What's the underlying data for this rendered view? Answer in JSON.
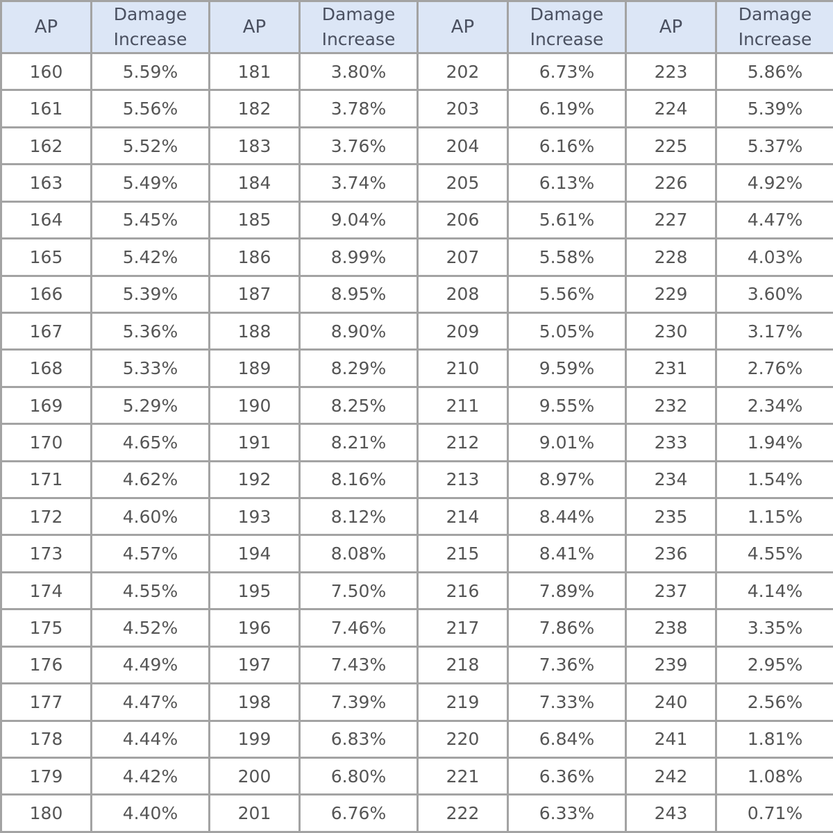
{
  "headers": {
    "ap": "AP",
    "damage_line1": "Damage",
    "damage_line2": "Increase"
  },
  "groups": [
    {
      "rows": [
        [
          "160",
          "5.59%"
        ],
        [
          "161",
          "5.56%"
        ],
        [
          "162",
          "5.52%"
        ],
        [
          "163",
          "5.49%"
        ],
        [
          "164",
          "5.45%"
        ],
        [
          "165",
          "5.42%"
        ],
        [
          "166",
          "5.39%"
        ],
        [
          "167",
          "5.36%"
        ],
        [
          "168",
          "5.33%"
        ],
        [
          "169",
          "5.29%"
        ],
        [
          "170",
          "4.65%"
        ],
        [
          "171",
          "4.62%"
        ],
        [
          "172",
          "4.60%"
        ],
        [
          "173",
          "4.57%"
        ],
        [
          "174",
          "4.55%"
        ],
        [
          "175",
          "4.52%"
        ],
        [
          "176",
          "4.49%"
        ],
        [
          "177",
          "4.47%"
        ],
        [
          "178",
          "4.44%"
        ],
        [
          "179",
          "4.42%"
        ],
        [
          "180",
          "4.40%"
        ]
      ]
    },
    {
      "rows": [
        [
          "181",
          "3.80%"
        ],
        [
          "182",
          "3.78%"
        ],
        [
          "183",
          "3.76%"
        ],
        [
          "184",
          "3.74%"
        ],
        [
          "185",
          "9.04%"
        ],
        [
          "186",
          "8.99%"
        ],
        [
          "187",
          "8.95%"
        ],
        [
          "188",
          "8.90%"
        ],
        [
          "189",
          "8.29%"
        ],
        [
          "190",
          "8.25%"
        ],
        [
          "191",
          "8.21%"
        ],
        [
          "192",
          "8.16%"
        ],
        [
          "193",
          "8.12%"
        ],
        [
          "194",
          "8.08%"
        ],
        [
          "195",
          "7.50%"
        ],
        [
          "196",
          "7.46%"
        ],
        [
          "197",
          "7.43%"
        ],
        [
          "198",
          "7.39%"
        ],
        [
          "199",
          "6.83%"
        ],
        [
          "200",
          "6.80%"
        ],
        [
          "201",
          "6.76%"
        ]
      ]
    },
    {
      "rows": [
        [
          "202",
          "6.73%"
        ],
        [
          "203",
          "6.19%"
        ],
        [
          "204",
          "6.16%"
        ],
        [
          "205",
          "6.13%"
        ],
        [
          "206",
          "5.61%"
        ],
        [
          "207",
          "5.58%"
        ],
        [
          "208",
          "5.56%"
        ],
        [
          "209",
          "5.05%"
        ],
        [
          "210",
          "9.59%"
        ],
        [
          "211",
          "9.55%"
        ],
        [
          "212",
          "9.01%"
        ],
        [
          "213",
          "8.97%"
        ],
        [
          "214",
          "8.44%"
        ],
        [
          "215",
          "8.41%"
        ],
        [
          "216",
          "7.89%"
        ],
        [
          "217",
          "7.86%"
        ],
        [
          "218",
          "7.36%"
        ],
        [
          "219",
          "7.33%"
        ],
        [
          "220",
          "6.84%"
        ],
        [
          "221",
          "6.36%"
        ],
        [
          "222",
          "6.33%"
        ]
      ]
    },
    {
      "rows": [
        [
          "223",
          "5.86%"
        ],
        [
          "224",
          "5.39%"
        ],
        [
          "225",
          "5.37%"
        ],
        [
          "226",
          "4.92%"
        ],
        [
          "227",
          "4.47%"
        ],
        [
          "228",
          "4.03%"
        ],
        [
          "229",
          "3.60%"
        ],
        [
          "230",
          "3.17%"
        ],
        [
          "231",
          "2.76%"
        ],
        [
          "232",
          "2.34%"
        ],
        [
          "233",
          "1.94%"
        ],
        [
          "234",
          "1.54%"
        ],
        [
          "235",
          "1.15%"
        ],
        [
          "236",
          "4.55%"
        ],
        [
          "237",
          "4.14%"
        ],
        [
          "238",
          "3.35%"
        ],
        [
          "239",
          "2.95%"
        ],
        [
          "240",
          "2.56%"
        ],
        [
          "241",
          "1.81%"
        ],
        [
          "242",
          "1.08%"
        ],
        [
          "243",
          "0.71%"
        ]
      ]
    }
  ],
  "colors": {
    "header_bg": "#dce6f6",
    "border": "#a3a3a3",
    "text": "#555555"
  }
}
